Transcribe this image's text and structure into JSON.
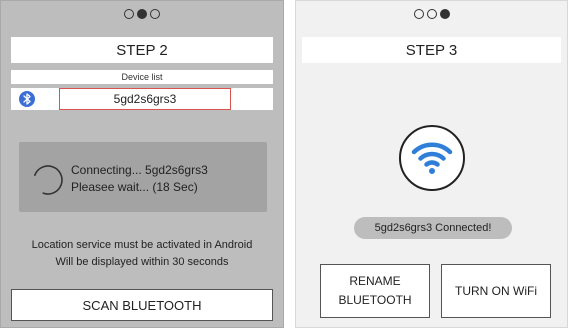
{
  "left_screen": {
    "pager": {
      "total": 3,
      "active_index": 1
    },
    "step_title": "STEP 2",
    "device_list_label": "Device list",
    "device_icon": "bluetooth-icon",
    "device_name": "5gd2s6grs3",
    "connecting_line1": "Connecting... 5gd2s6grs3",
    "connecting_line2": "Pleasee wait... (18 Sec)",
    "location_note_line1": "Location service must be activated in Android",
    "location_note_line2": "Will be displayed within 30 seconds",
    "scan_button": "SCAN BLUETOOTH"
  },
  "right_screen": {
    "pager": {
      "total": 3,
      "active_index": 2
    },
    "step_title": "STEP 3",
    "status_icon": "wifi-icon",
    "wifi_color": "#2f7fd8",
    "connected_status": "5gd2s6grs3 Connected!",
    "rename_button_line1": "RENAME",
    "rename_button_line2": "BLUETOOTH",
    "wifi_button": "TURN ON WiFi"
  }
}
